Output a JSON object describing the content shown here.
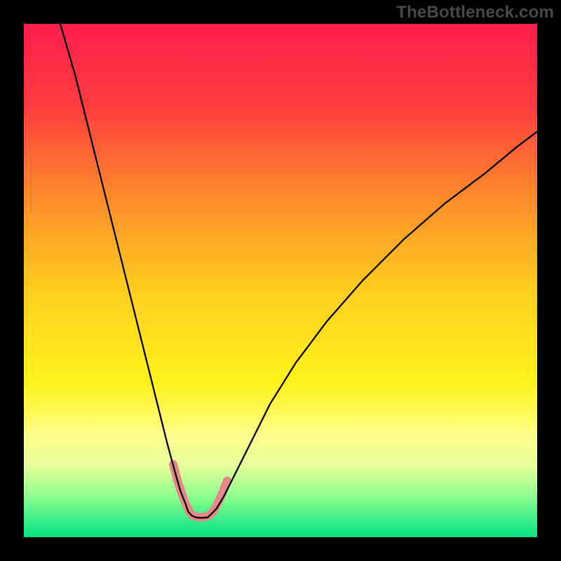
{
  "watermark": "TheBottleneck.com",
  "chart_data": {
    "type": "line",
    "title": "",
    "xlabel": "",
    "ylabel": "",
    "xlim": [
      0,
      100
    ],
    "ylim": [
      0,
      100
    ],
    "background_gradient": {
      "stops": [
        {
          "offset": 0,
          "color": "#ff1e4c"
        },
        {
          "offset": 0.16,
          "color": "#ff3d3f"
        },
        {
          "offset": 0.34,
          "color": "#ff8b2a"
        },
        {
          "offset": 0.52,
          "color": "#ffcf20"
        },
        {
          "offset": 0.7,
          "color": "#fff21a"
        },
        {
          "offset": 0.8,
          "color": "#ffff8a"
        },
        {
          "offset": 0.86,
          "color": "#e7ff9a"
        },
        {
          "offset": 0.92,
          "color": "#8dff8d"
        },
        {
          "offset": 1.0,
          "color": "#00e383"
        }
      ]
    },
    "series": [
      {
        "name": "curve-left",
        "color": "#000000",
        "width": 2.3,
        "x": [
          7.1,
          10,
          13,
          16,
          19,
          22,
          24.5,
          26.5,
          28,
          29.5,
          30.5,
          31.5,
          32,
          32.7
        ],
        "y": [
          100,
          90,
          78,
          66,
          54,
          42,
          32,
          24,
          18,
          12.5,
          9,
          6.5,
          5,
          4.2
        ]
      },
      {
        "name": "curve-right",
        "color": "#000000",
        "width": 2.3,
        "x": [
          36.2,
          37.5,
          39,
          41,
          44,
          48,
          53,
          59,
          66,
          74,
          82,
          90,
          96,
          100
        ],
        "y": [
          4.2,
          5.5,
          8,
          12,
          18,
          26,
          34,
          42,
          50,
          58,
          65,
          71,
          76,
          79
        ]
      },
      {
        "name": "floor",
        "color": "#000000",
        "width": 2.3,
        "x": [
          32.7,
          33.5,
          34.5,
          35.8,
          36.2
        ],
        "y": [
          4.2,
          3.85,
          3.75,
          3.85,
          4.2
        ]
      },
      {
        "name": "highlight-left",
        "color": "#e58688",
        "width": 12,
        "cap": "round",
        "x": [
          29.1,
          29.9,
          30.6,
          31.2,
          31.8,
          32.3,
          32.7
        ],
        "y": [
          14.2,
          11.2,
          9.0,
          7.3,
          5.9,
          4.9,
          4.3
        ]
      },
      {
        "name": "highlight-right",
        "color": "#e58688",
        "width": 12,
        "cap": "round",
        "x": [
          36.2,
          36.9,
          37.5,
          38.2,
          38.9,
          39.6
        ],
        "y": [
          4.3,
          5.0,
          6.1,
          7.5,
          9.2,
          11.0
        ]
      },
      {
        "name": "highlight-floor",
        "color": "#e58688",
        "width": 12,
        "cap": "round",
        "x": [
          32.7,
          33.8,
          35.0,
          36.2
        ],
        "y": [
          4.3,
          3.9,
          3.9,
          4.3
        ]
      }
    ]
  }
}
